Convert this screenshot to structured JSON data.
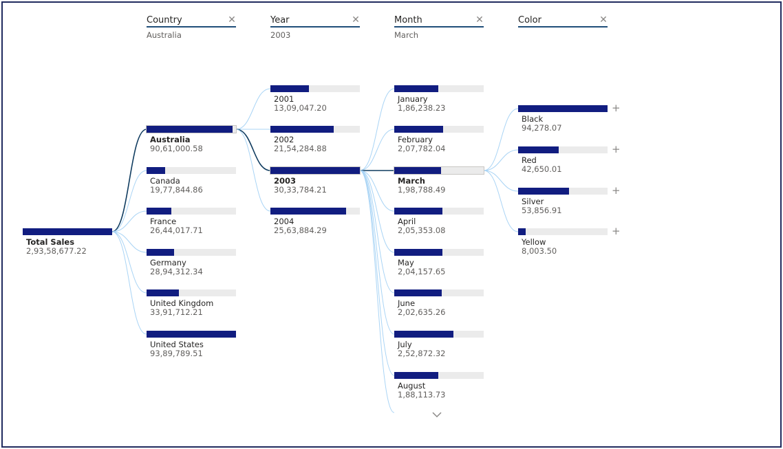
{
  "columns": [
    {
      "title": "Country",
      "selected": "Australia",
      "close_icon": "close-icon"
    },
    {
      "title": "Year",
      "selected": "2003",
      "close_icon": "close-icon"
    },
    {
      "title": "Month",
      "selected": "March",
      "close_icon": "close-icon"
    },
    {
      "title": "Color",
      "selected": "",
      "close_icon": "close-icon"
    }
  ],
  "root": {
    "label": "Total Sales",
    "value": "2,93,58,677.22",
    "fill_fraction": 1.0
  },
  "country": [
    {
      "label": "Australia",
      "value": "90,61,000.58",
      "fill_fraction": 0.965
    },
    {
      "label": "Canada",
      "value": "19,77,844.86",
      "fill_fraction": 0.21
    },
    {
      "label": "France",
      "value": "26,44,017.71",
      "fill_fraction": 0.28
    },
    {
      "label": "Germany",
      "value": "28,94,312.34",
      "fill_fraction": 0.31
    },
    {
      "label": "United Kingdom",
      "value": "33,91,712.21",
      "fill_fraction": 0.36
    },
    {
      "label": "United States",
      "value": "93,89,789.51",
      "fill_fraction": 1.0
    }
  ],
  "year": [
    {
      "label": "2001",
      "value": "13,09,047.20",
      "fill_fraction": 0.43
    },
    {
      "label": "2002",
      "value": "21,54,284.88",
      "fill_fraction": 0.71
    },
    {
      "label": "2003",
      "value": "30,33,784.21",
      "fill_fraction": 1.0
    },
    {
      "label": "2004",
      "value": "25,63,884.29",
      "fill_fraction": 0.845
    }
  ],
  "month": [
    {
      "label": "January",
      "value": "1,86,238.23",
      "fill_fraction": 0.49
    },
    {
      "label": "February",
      "value": "2,07,782.04",
      "fill_fraction": 0.545
    },
    {
      "label": "March",
      "value": "1,98,788.49",
      "fill_fraction": 0.52
    },
    {
      "label": "April",
      "value": "2,05,353.08",
      "fill_fraction": 0.54
    },
    {
      "label": "May",
      "value": "2,04,157.65",
      "fill_fraction": 0.535
    },
    {
      "label": "June",
      "value": "2,02,635.26",
      "fill_fraction": 0.53
    },
    {
      "label": "July",
      "value": "2,52,872.32",
      "fill_fraction": 0.665
    },
    {
      "label": "August",
      "value": "1,88,113.73",
      "fill_fraction": 0.495
    }
  ],
  "color": [
    {
      "label": "Black",
      "value": "94,278.07",
      "fill_fraction": 1.0,
      "expand_label": "+"
    },
    {
      "label": "Red",
      "value": "42,650.01",
      "fill_fraction": 0.45,
      "expand_label": "+"
    },
    {
      "label": "Silver",
      "value": "53,856.91",
      "fill_fraction": 0.57,
      "expand_label": "+"
    },
    {
      "label": "Yellow",
      "value": "8,003.50",
      "fill_fraction": 0.085,
      "expand_label": "+"
    }
  ],
  "colors": {
    "bar_fill": "#111d80",
    "bar_track": "#ebebeb",
    "active_link": "#0f3b5f",
    "inactive_link": "#a9d4f5",
    "header_underline": "#1f4e79"
  },
  "scroll_icon": "chevron-down-icon"
}
